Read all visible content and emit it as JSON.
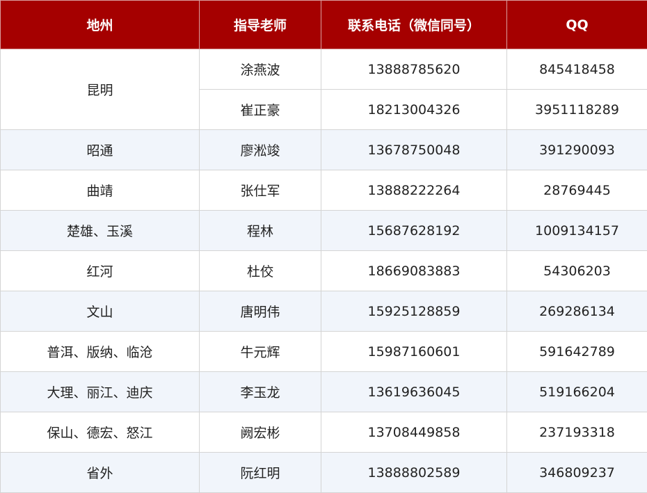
{
  "headers": {
    "region": "地州",
    "teacher": "指导老师",
    "phone": "联系电话（微信同号）",
    "qq": "QQ"
  },
  "rows": [
    {
      "region": "昆明",
      "teacher": "涂燕波",
      "phone": "13888785620",
      "qq": "845418458"
    },
    {
      "region": "昆明",
      "teacher": "崔正豪",
      "phone": "18213004326",
      "qq": "3951118289"
    },
    {
      "region": "昭通",
      "teacher": "廖淞竣",
      "phone": "13678750048",
      "qq": "391290093"
    },
    {
      "region": "曲靖",
      "teacher": "张仕军",
      "phone": "13888222264",
      "qq": "28769445"
    },
    {
      "region": "楚雄、玉溪",
      "teacher": "程林",
      "phone": "15687628192",
      "qq": "1009134157"
    },
    {
      "region": "红河",
      "teacher": "杜佼",
      "phone": "18669083883",
      "qq": "54306203"
    },
    {
      "region": "文山",
      "teacher": "唐明伟",
      "phone": "15925128859",
      "qq": "269286134"
    },
    {
      "region": "普洱、版纳、临沧",
      "teacher": "牛元辉",
      "phone": "15987160601",
      "qq": "591642789"
    },
    {
      "region": "大理、丽江、迪庆",
      "teacher": "李玉龙",
      "phone": "13619636045",
      "qq": "519166204"
    },
    {
      "region": "保山、德宏、怒江",
      "teacher": "阙宏彬",
      "phone": "13708449858",
      "qq": "237193318"
    },
    {
      "region": "省外",
      "teacher": "阮红明",
      "phone": "13888802589",
      "qq": "346809237"
    }
  ],
  "colors": {
    "header_bg": "#a50000",
    "header_text": "#ffffff",
    "alt_row_bg": "#f1f5fb"
  }
}
